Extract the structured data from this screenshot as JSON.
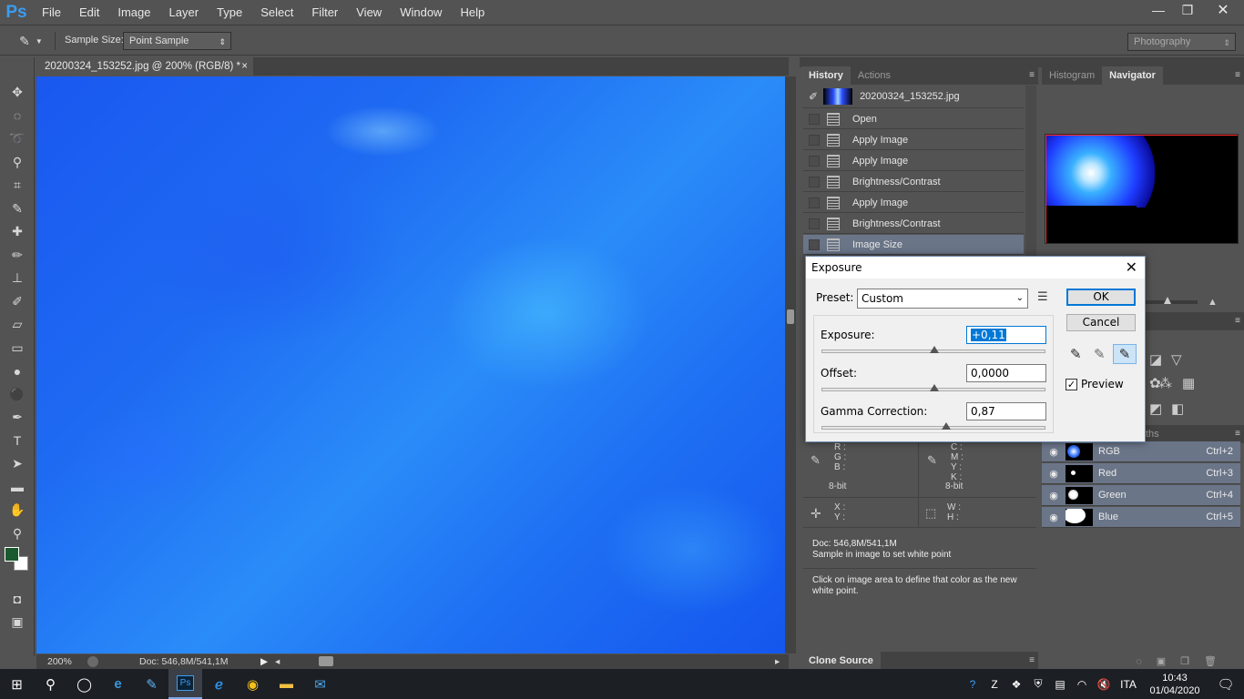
{
  "app": {
    "logo": "Ps"
  },
  "menu": [
    "File",
    "Edit",
    "Image",
    "Layer",
    "Type",
    "Select",
    "Filter",
    "View",
    "Window",
    "Help"
  ],
  "window_controls": {
    "minimize": "—",
    "restore": "❐",
    "close": "✕"
  },
  "options_bar": {
    "sample_size_label": "Sample Size:",
    "sample_size_value": "Point Sample",
    "workspace": "Photography"
  },
  "document": {
    "tab_title": "20200324_153252.jpg @ 200% (RGB/8) *",
    "tab_close": "×",
    "zoom": "200%",
    "doc_size": "Doc: 546,8M/541,1M"
  },
  "history_panel": {
    "tabs": [
      "History",
      "Actions"
    ],
    "snapshot": "20200324_153252.jpg",
    "steps": [
      "Open",
      "Apply Image",
      "Apply Image",
      "Brightness/Contrast",
      "Apply Image",
      "Brightness/Contrast",
      "Image Size"
    ]
  },
  "navigator_panel": {
    "tabs": [
      "Histogram",
      "Navigator"
    ]
  },
  "info_panel": {
    "rgb": {
      "r": "R :",
      "g": "G :",
      "b": "B :",
      "depth": "8-bit"
    },
    "cmyk": {
      "c": "C :",
      "m": "M :",
      "y": "Y :",
      "k": "K :",
      "depth": "8-bit"
    },
    "xy": {
      "x": "X :",
      "y": "Y :"
    },
    "wh": {
      "w": "W :",
      "h": "H :"
    },
    "doc": "Doc: 546,8M/541,1M",
    "hint1": "Sample in image to set white point",
    "hint2": "Click on image area to define that color as the new white point."
  },
  "clone_source": {
    "label": "Clone Source"
  },
  "channels_panel": {
    "tab_partial": "ths",
    "channels": [
      {
        "name": "RGB",
        "shortcut": "Ctrl+2"
      },
      {
        "name": "Red",
        "shortcut": "Ctrl+3"
      },
      {
        "name": "Green",
        "shortcut": "Ctrl+4"
      },
      {
        "name": "Blue",
        "shortcut": "Ctrl+5"
      }
    ]
  },
  "exposure_dialog": {
    "title": "Exposure",
    "preset_label": "Preset:",
    "preset_value": "Custom",
    "exposure_label": "Exposure:",
    "exposure_value": "+0,11",
    "exposure_fraction": 0.5,
    "offset_label": "Offset:",
    "offset_value": "0,0000",
    "gamma_label": "Gamma Correction:",
    "gamma_value": "0,87",
    "ok": "OK",
    "cancel": "Cancel",
    "preview_label": "Preview",
    "preview_checked": true
  },
  "taskbar": {
    "lang": "ITA",
    "time": "10:43",
    "date": "01/04/2020"
  },
  "colors": {
    "accent": "#0078d7",
    "panel": "#535353",
    "panel_dark": "#424242",
    "canvas_blue": "#1e6af2"
  }
}
